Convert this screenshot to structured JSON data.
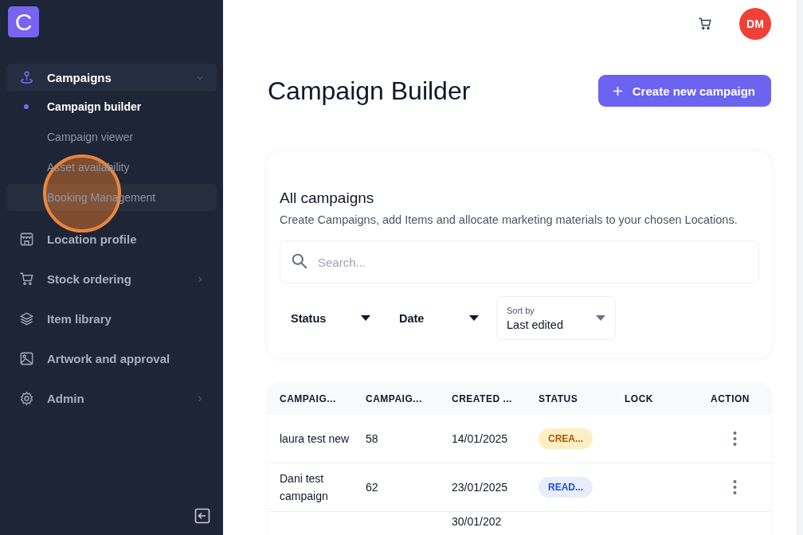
{
  "sidebar": {
    "logo": "C",
    "items": [
      {
        "label": "Campaigns",
        "expanded": true,
        "active": true,
        "children": [
          {
            "label": "Campaign builder",
            "selected": true,
            "highlighted": false
          },
          {
            "label": "Campaign viewer",
            "selected": false,
            "highlighted": false
          },
          {
            "label": "Asset availability",
            "selected": false,
            "highlighted": false
          },
          {
            "label": "Booking Management",
            "selected": false,
            "highlighted": true
          }
        ]
      },
      {
        "label": "Location profile",
        "active": false
      },
      {
        "label": "Stock ordering",
        "expanded": false,
        "active": false
      },
      {
        "label": "Item library",
        "active": false
      },
      {
        "label": "Artwork and approval",
        "active": false
      },
      {
        "label": "Admin",
        "expanded": false,
        "active": false
      }
    ]
  },
  "header": {
    "avatar": "DM"
  },
  "page": {
    "title": "Campaign Builder",
    "create_button": "Create new campaign"
  },
  "filters_card": {
    "title": "All campaigns",
    "description": "Create Campaigns, add Items and allocate marketing materials to your chosen Locations.",
    "search": {
      "placeholder": "Search..."
    },
    "filters": [
      {
        "label": "Status"
      },
      {
        "label": "Date"
      }
    ],
    "sort": {
      "label": "Sort by",
      "value": "Last edited"
    }
  },
  "table": {
    "columns": [
      "CAMPAIG...",
      "CAMPAIG...",
      "CREATED ...",
      "STATUS",
      "LOCK",
      "ACTION"
    ],
    "rows": [
      {
        "name": "laura test new",
        "id": "58",
        "created": "14/01/2025",
        "status": {
          "text": "CREA...",
          "color": "#b45309"
        }
      },
      {
        "name": "Dani test campaign",
        "id": "62",
        "created": "23/01/2025",
        "status": {
          "text": "READ...",
          "color": "#1d4ed8"
        }
      },
      {
        "created": "30/01/202"
      }
    ]
  }
}
